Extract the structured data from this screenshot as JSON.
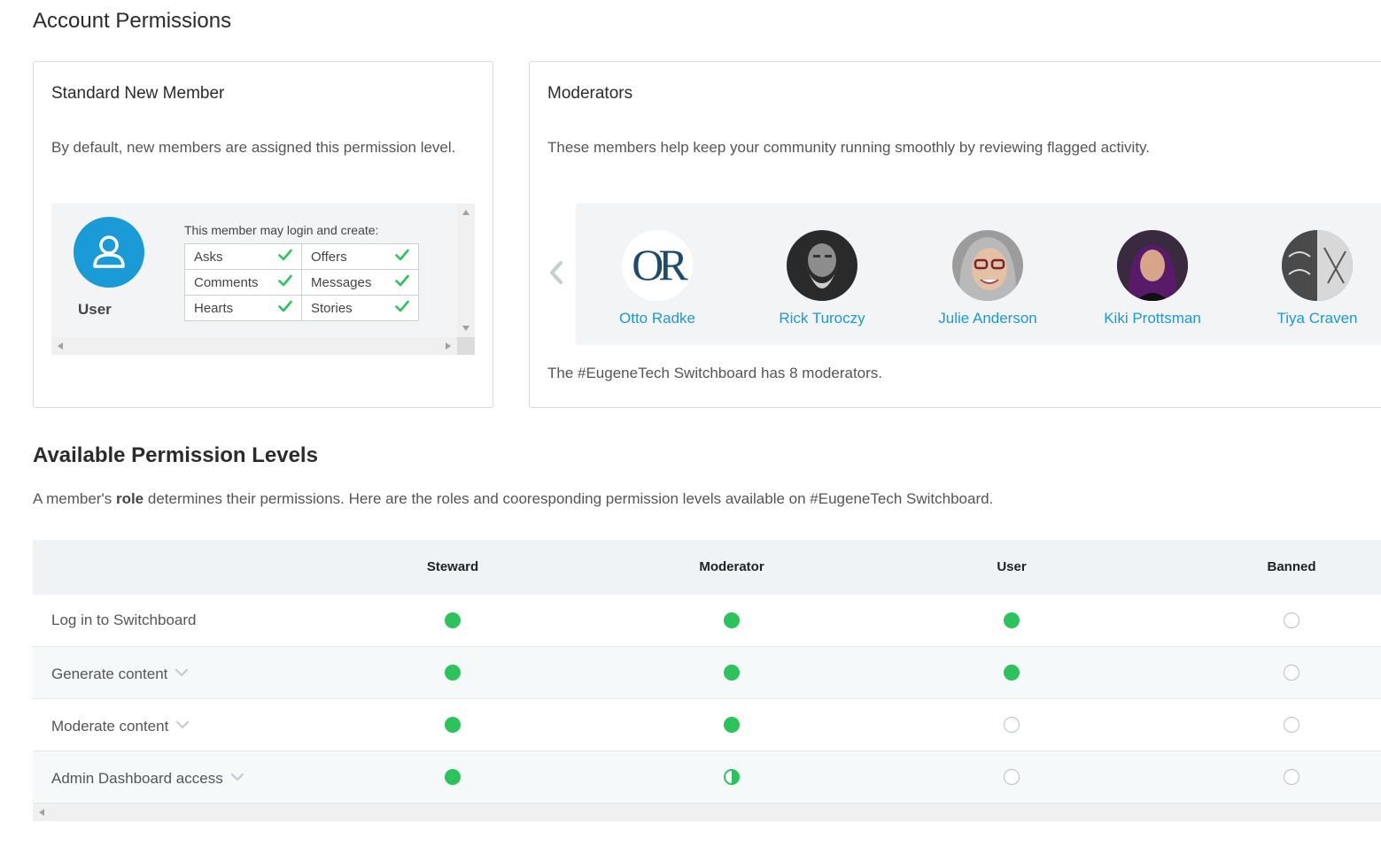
{
  "page_title": "Account Permissions",
  "standard": {
    "title": "Standard New Member",
    "description": "By default, new members are assigned this permission level.",
    "role_name": "User",
    "may_label": "This member may login and create:",
    "permissions": [
      [
        "Asks",
        "Offers"
      ],
      [
        "Comments",
        "Messages"
      ],
      [
        "Hearts",
        "Stories"
      ]
    ]
  },
  "moderators": {
    "title": "Moderators",
    "description": "These members help keep your community running smoothly by reviewing flagged activity.",
    "people": [
      {
        "name": "Otto Radke",
        "avatar": "logo-or"
      },
      {
        "name": "Rick Turoczy",
        "avatar": "photo"
      },
      {
        "name": "Julie Anderson",
        "avatar": "photo"
      },
      {
        "name": "Kiki Prottsman",
        "avatar": "photo"
      },
      {
        "name": "Tiya Craven",
        "avatar": "photo"
      }
    ],
    "footer": "The #EugeneTech Switchboard has 8 moderators."
  },
  "levels": {
    "title": "Available Permission Levels",
    "desc_before": "A member's ",
    "desc_bold": "role",
    "desc_after": " determines their permissions. Here are the roles and cooresponding permission levels available on #EugeneTech Switchboard.",
    "columns": [
      "Steward",
      "Moderator",
      "User",
      "Banned"
    ],
    "rows": [
      {
        "label": "Log in to Switchboard",
        "expandable": false,
        "values": [
          "full",
          "full",
          "full",
          "none"
        ]
      },
      {
        "label": "Generate content",
        "expandable": true,
        "values": [
          "full",
          "full",
          "full",
          "none"
        ]
      },
      {
        "label": "Moderate content",
        "expandable": true,
        "values": [
          "full",
          "full",
          "none",
          "none"
        ]
      },
      {
        "label": "Admin Dashboard access",
        "expandable": true,
        "values": [
          "full",
          "half",
          "none",
          "none"
        ]
      }
    ]
  },
  "colors": {
    "accent": "#1a9ad6",
    "granted": "#2cc25c",
    "not_granted": "#b9bfc3"
  }
}
